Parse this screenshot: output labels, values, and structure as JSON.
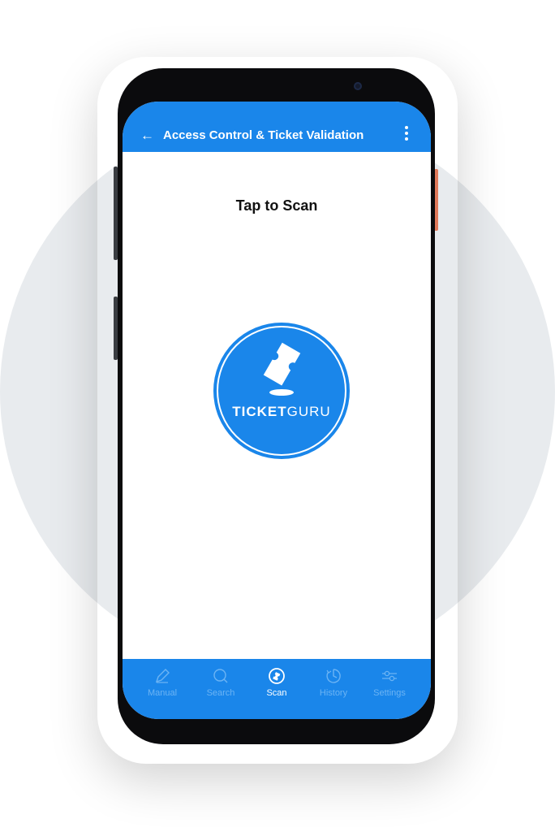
{
  "appbar": {
    "back_glyph": "←",
    "title": "Access Control & Ticket Validation",
    "menu_icon": "kebab-menu-icon"
  },
  "main": {
    "heading": "Tap to Scan",
    "logo": {
      "bold_text": "TICKET",
      "light_text": "GURU",
      "icon": "ticket-icon"
    }
  },
  "bottom_nav": {
    "items": [
      {
        "label": "Manual",
        "icon": "pencil-icon",
        "active": false
      },
      {
        "label": "Search",
        "icon": "search-icon",
        "active": false
      },
      {
        "label": "Scan",
        "icon": "scan-icon",
        "active": true
      },
      {
        "label": "History",
        "icon": "history-icon",
        "active": false
      },
      {
        "label": "Settings",
        "icon": "sliders-icon",
        "active": false
      }
    ]
  },
  "colors": {
    "primary": "#1a86ea",
    "inactive_nav": "#6cb4f4",
    "background_circle": "#e8ebee",
    "phone_body": "#0b0b0d"
  }
}
